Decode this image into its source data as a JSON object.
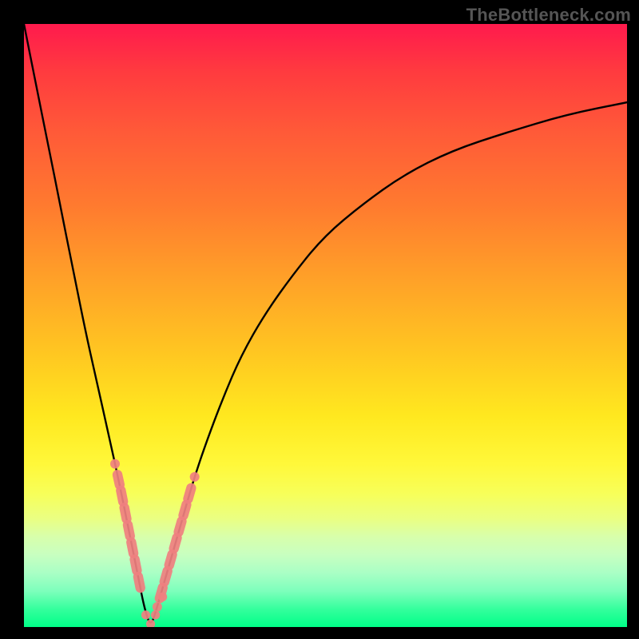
{
  "watermark": "TheBottleneck.com",
  "chart_data": {
    "type": "line",
    "title": "",
    "xlabel": "",
    "ylabel": "",
    "xlim": [
      0,
      100
    ],
    "ylim": [
      0,
      100
    ],
    "series": [
      {
        "name": "bottleneck-curve",
        "x": [
          0,
          2,
          4,
          6,
          8,
          10,
          12,
          14,
          16,
          18,
          19,
          20,
          21,
          22,
          24,
          26,
          28,
          30,
          33,
          36,
          40,
          45,
          50,
          56,
          63,
          71,
          80,
          90,
          100
        ],
        "y": [
          100,
          90,
          80,
          70,
          60,
          50,
          41,
          32,
          23,
          13,
          8,
          3,
          0,
          3,
          10,
          17,
          24,
          30,
          38,
          45,
          52,
          59,
          65,
          70,
          75,
          79,
          82,
          85,
          87
        ]
      }
    ],
    "markers": [
      {
        "name": "cluster-left",
        "x_range": [
          15.5,
          19.5
        ],
        "y_range": [
          8,
          30
        ],
        "color": "#f08080"
      },
      {
        "name": "cluster-right",
        "x_range": [
          22.5,
          28.0
        ],
        "y_range": [
          4,
          30
        ],
        "color": "#f08080"
      }
    ],
    "gradient_meaning": "red-high to green-low bottleneck severity"
  }
}
